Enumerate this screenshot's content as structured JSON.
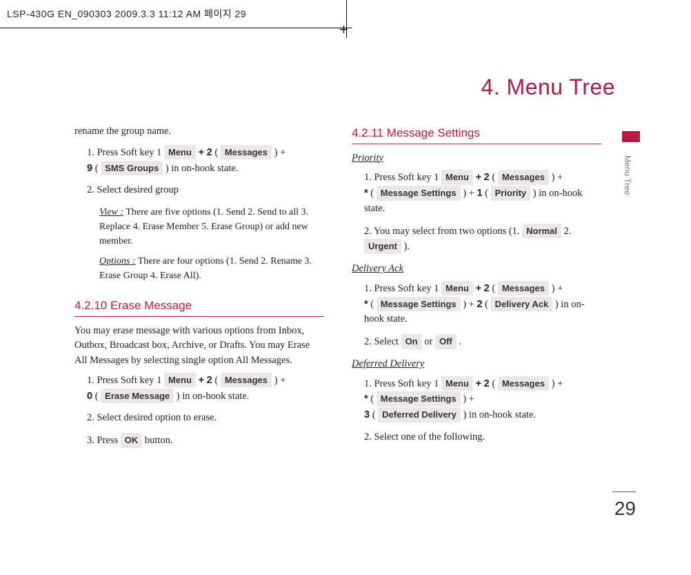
{
  "crop": {
    "header": "LSP-430G EN_090303  2009.3.3 11:12 AM  페이지 29"
  },
  "chapter_title": "4. Menu Tree",
  "side_label": "Menu Tree",
  "page_number": "29",
  "keys": {
    "menu": "Menu",
    "messages": "Messages",
    "sms_groups": "SMS Groups",
    "erase_message": "Erase Message",
    "ok": "OK",
    "message_settings": "Message Settings",
    "priority": "Priority",
    "normal": "Normal",
    "urgent": "Urgent",
    "delivery_ack": "Delivery Ack",
    "on": "On",
    "off": "Off",
    "deferred_delivery": "Deferred Delivery"
  },
  "chars": {
    "plus": "+",
    "two": "2",
    "nine": "9",
    "zero": "0",
    "one": "1",
    "three": "3",
    "star": "*"
  },
  "left": {
    "intro_top": "rename the group name.",
    "s1_a": "1. Press Soft key 1 ",
    "s1_b": " ( ",
    "s1_c": " ) + ",
    "s1_d": " ( ",
    "s1_e": " ) in on-hook state.",
    "s2": "2.  Select desired group",
    "view_label": "View :",
    "view_text": " There are five options (1. Send 2. Send to all  3. Replace  4. Erase Member  5. Erase Group) or add new member.",
    "options_label": "Options :",
    "options_text": " There are four options (1. Send 2. Rename  3. Erase Group 4. Erase All).",
    "head_4210": "4.2.10 Erase Message",
    "para_erase": "You may erase message with various options from Inbox, Outbox, Broadcast box, Archive, or Drafts. You may Erase All Messages by selecting single option All Messages.",
    "em_s1_a": "1. Press Soft key 1 ",
    "em_s1_c": " ( ",
    "em_s1_e": " ) in on-hook state.",
    "em_s2": "2. Select desired option to erase.",
    "em_s3_a": "3. Press ",
    "em_s3_b": " button."
  },
  "right": {
    "head_4211": "4.2.11 Message Settings",
    "priority_label": "Priority",
    "pr_s1_a": "1. Press Soft key 1 ",
    "pr_s1_b": " ( ",
    "pr_s1_c": " ) + ",
    "pr_s1_d": " ( ",
    "pr_s1_e": " ) + ",
    "pr_s1_f": " ( ",
    "pr_s1_g": " ) in on-hook state.",
    "pr_s2_a": "2. You may select from two options (1. ",
    "pr_s2_b": " 2. ",
    "pr_s2_c": " ).",
    "delivery_ack_label": "Delivery Ack",
    "da_s1_g": " ) in on- hook state.",
    "da_s2_a": "2. Select  ",
    "da_s2_b": "  or  ",
    "da_s2_c": " .",
    "deferred_label": "Deferred Delivery",
    "dd_s1_e": " ) + ",
    "dd_s1_g": " ) in on-hook state.",
    "dd_s2": "2. Select one of the following."
  }
}
